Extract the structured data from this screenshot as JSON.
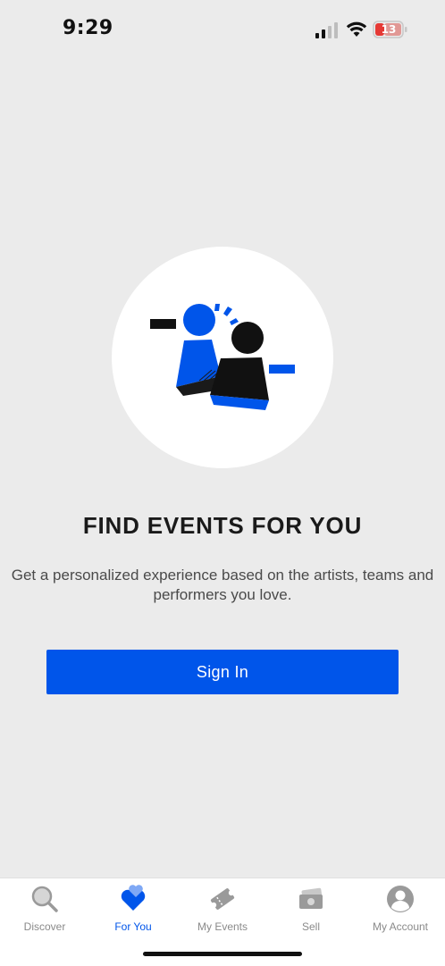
{
  "status_bar": {
    "time": "9:29",
    "battery_level": "13",
    "signal_icon": "cellular-signal-icon",
    "wifi_icon": "wifi-icon",
    "battery_icon": "battery-charging-icon",
    "battery_color": "#e53935"
  },
  "main": {
    "illustration": "people-illustration",
    "headline": "FIND EVENTS FOR YOU",
    "subtext": "Get a personalized experience based on the artists, teams and performers you love.",
    "signin_label": "Sign In"
  },
  "bottom_nav": {
    "items": [
      {
        "label": "Discover",
        "icon": "search-icon",
        "active": false
      },
      {
        "label": "For You",
        "icon": "heart-icon",
        "active": true
      },
      {
        "label": "My Events",
        "icon": "ticket-icon",
        "active": false
      },
      {
        "label": "Sell",
        "icon": "money-icon",
        "active": false
      },
      {
        "label": "My Account",
        "icon": "person-icon",
        "active": false
      }
    ]
  },
  "colors": {
    "accent": "#0055ea",
    "background": "#ebebeb",
    "inactive": "#8a8a8a"
  }
}
